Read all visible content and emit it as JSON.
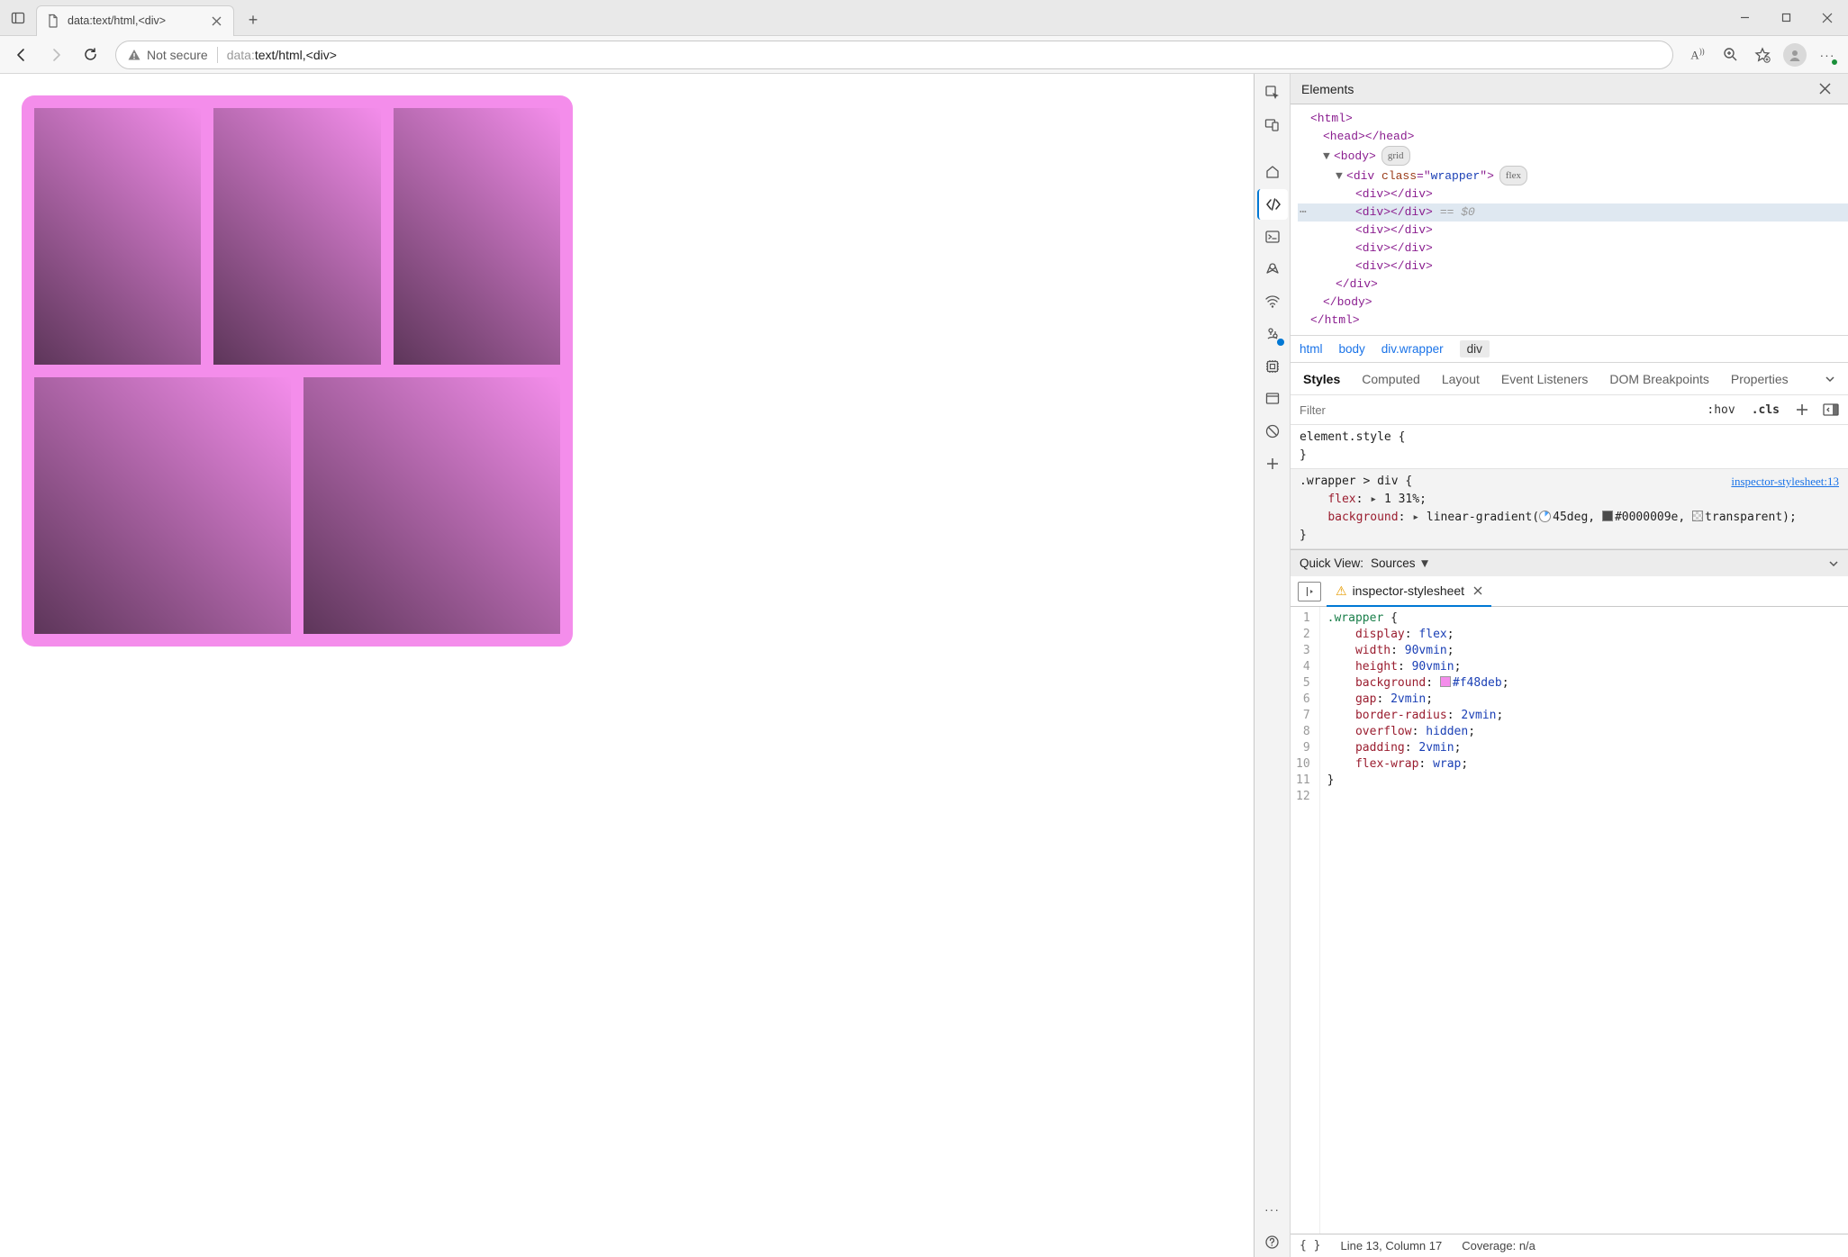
{
  "browser": {
    "tab_title": "data:text/html,<div>",
    "security_label": "Not secure",
    "url_proto": "data:",
    "url_rest": "text/html,<div>"
  },
  "page_css": {
    "wrapper_bg": "#f48deb"
  },
  "devtools": {
    "panel_title": "Elements",
    "dom": {
      "html_open": "<html>",
      "head": "<head></head>",
      "body_open": "<body>",
      "body_badge": "grid",
      "wrapper_open_tag": "div",
      "wrapper_attr_name": "class",
      "wrapper_attr_val": "wrapper",
      "wrapper_badge": "flex",
      "child": "<div></div>",
      "selected_marker": "== $0",
      "wrapper_close": "</div>",
      "body_close": "</body>",
      "html_close": "</html>"
    },
    "breadcrumb": [
      "html",
      "body",
      "div.wrapper",
      "div"
    ],
    "styles_tabs": [
      "Styles",
      "Computed",
      "Layout",
      "Event Listeners",
      "DOM Breakpoints",
      "Properties"
    ],
    "filter_placeholder": "Filter",
    "hov": ":hov",
    "cls": ".cls",
    "rule1_selector": "element.style {",
    "rule1_close": "}",
    "rule2_selector": ".wrapper > div {",
    "rule2_link": "inspector-stylesheet:13",
    "rule2_p1_name": "flex",
    "rule2_p1_val": "1 31%",
    "rule2_p2_name": "background",
    "rule2_p2_prefix": "linear-gradient(",
    "rule2_p2_angle": "45deg",
    "rule2_p2_c1": "#0000009e",
    "rule2_p2_c2": "transparent",
    "rule2_close": "}",
    "quickview_label": "Quick View:",
    "quickview_value": "Sources",
    "file_tab": "inspector-stylesheet",
    "editor_lines": [
      ".wrapper {",
      "    display: flex;",
      "    width: 90vmin;",
      "    height: 90vmin;",
      "    background: #f48deb;",
      "    gap: 2vmin;",
      "    border-radius: 2vmin;",
      "    overflow: hidden;",
      "    padding: 2vmin;",
      "    flex-wrap: wrap;",
      "}",
      ""
    ],
    "status_pos": "Line 13, Column 17",
    "status_cov": "Coverage: n/a"
  }
}
